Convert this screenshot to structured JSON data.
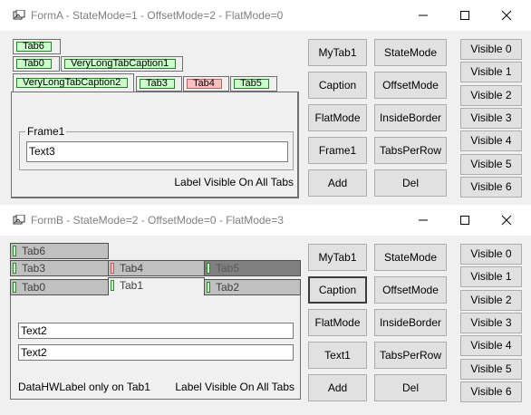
{
  "formA": {
    "title": "FormA - StateMode=1 - OffsetMode=2 - FlatMode=0",
    "tabs_row1": [
      "Tab6"
    ],
    "tabs_row2": [
      "Tab0",
      "VeryLongTabCaption1"
    ],
    "tabs_row3": [
      "VeryLongTabCaption2",
      "Tab3",
      "Tab4",
      "Tab5"
    ],
    "frame_title": "Frame1",
    "textbox": "Text3",
    "label_all": "Label Visible On All Tabs",
    "buttons_col1": [
      "MyTab1",
      "Caption",
      "FlatMode",
      "Frame1",
      "Add"
    ],
    "buttons_col2": [
      "StateMode",
      "OffsetMode",
      "InsideBorder",
      "TabsPerRow",
      "Del"
    ],
    "visible_buttons": [
      "Visible 0",
      "Visible 1",
      "Visible 2",
      "Visible 3",
      "Visible 4",
      "Visible 5",
      "Visible 6"
    ]
  },
  "formB": {
    "title": "FormB - StateMode=2 - OffsetMode=0 - FlatMode=3",
    "tabs_row1": [
      "Tab6"
    ],
    "tabs_row2": [
      "Tab3",
      "Tab4",
      "Tab5"
    ],
    "tabs_row3": [
      "Tab0",
      "Tab1",
      "Tab2"
    ],
    "textbox1": "Text2",
    "textbox2": "Text2",
    "label_tab1": "DataHWLabel only on Tab1",
    "label_all": "Label Visible On All Tabs",
    "buttons_col1": [
      "MyTab1",
      "Caption",
      "FlatMode",
      "Text1",
      "Add"
    ],
    "buttons_col2": [
      "StateMode",
      "OffsetMode",
      "InsideBorder",
      "TabsPerRow",
      "Del"
    ],
    "visible_buttons": [
      "Visible 0",
      "Visible 1",
      "Visible 2",
      "Visible 3",
      "Visible 4",
      "Visible 5",
      "Visible 6"
    ]
  },
  "colors": {
    "tab_green": "#ccffcc",
    "tab_pink": "#ffc0c0"
  },
  "icons": [
    "app-icon",
    "minimize-icon",
    "maximize-icon",
    "close-icon"
  ]
}
